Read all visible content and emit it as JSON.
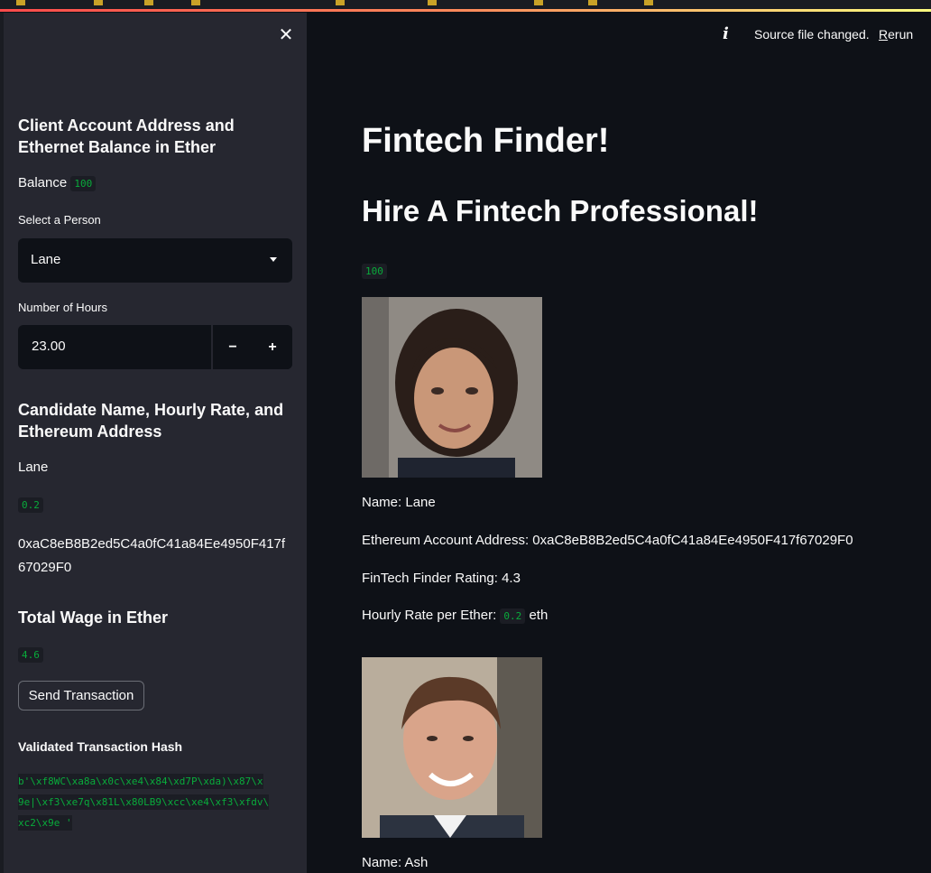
{
  "sidebar": {
    "close_icon": "close-icon",
    "heading_account": "Client Account Address and Ethernet Balance in Ether",
    "balance_label": "Balance",
    "balance_value": "100",
    "select_label": "Select a Person",
    "select_value": "Lane",
    "hours_label": "Number of Hours",
    "hours_value": "23.00",
    "minus_label": "−",
    "plus_label": "+",
    "heading_candidate": "Candidate Name, Hourly Rate, and Ethereum Address",
    "candidate_name": "Lane",
    "candidate_rate": "0.2",
    "candidate_address": "0xaC8eB8B2ed5C4a0fC41a84Ee4950F417f67029F0",
    "heading_wage": "Total Wage in Ether",
    "wage_value": "4.6",
    "send_button": "Send Transaction",
    "hash_heading": "Validated Transaction Hash",
    "hash_lines": [
      "b'\\xf8WC\\xa8a\\x0c\\xe4\\x84\\xd7P\\xda)\\x87\\x",
      "9e|\\xf3\\xe7q\\x81L\\x80LB9\\xcc\\xe4\\xf3\\xfdv\\",
      "xc2\\x9e '"
    ]
  },
  "header": {
    "status_text": "Source file changed.",
    "rerun_first": "R",
    "rerun_rest": "erun"
  },
  "main": {
    "title": "Fintech Finder!",
    "subtitle": "Hire A Fintech Professional!",
    "balance_value": "100",
    "candidates": [
      {
        "name_line": "Name: Lane",
        "address_line": "Ethereum Account Address: 0xaC8eB8B2ed5C4a0fC41a84Ee4950F417f67029F0",
        "rating_line": "FinTech Finder Rating: 4.3",
        "rate_prefix": "Hourly Rate per Ether:",
        "rate_value": "0.2",
        "rate_suffix": "eth"
      },
      {
        "name_line": "Name: Ash"
      }
    ]
  },
  "colors": {
    "app_bg": "#0e1117",
    "sidebar_bg": "#262730",
    "code_text": "#09ab3b",
    "accent_stripe": "#ff4b4b"
  }
}
